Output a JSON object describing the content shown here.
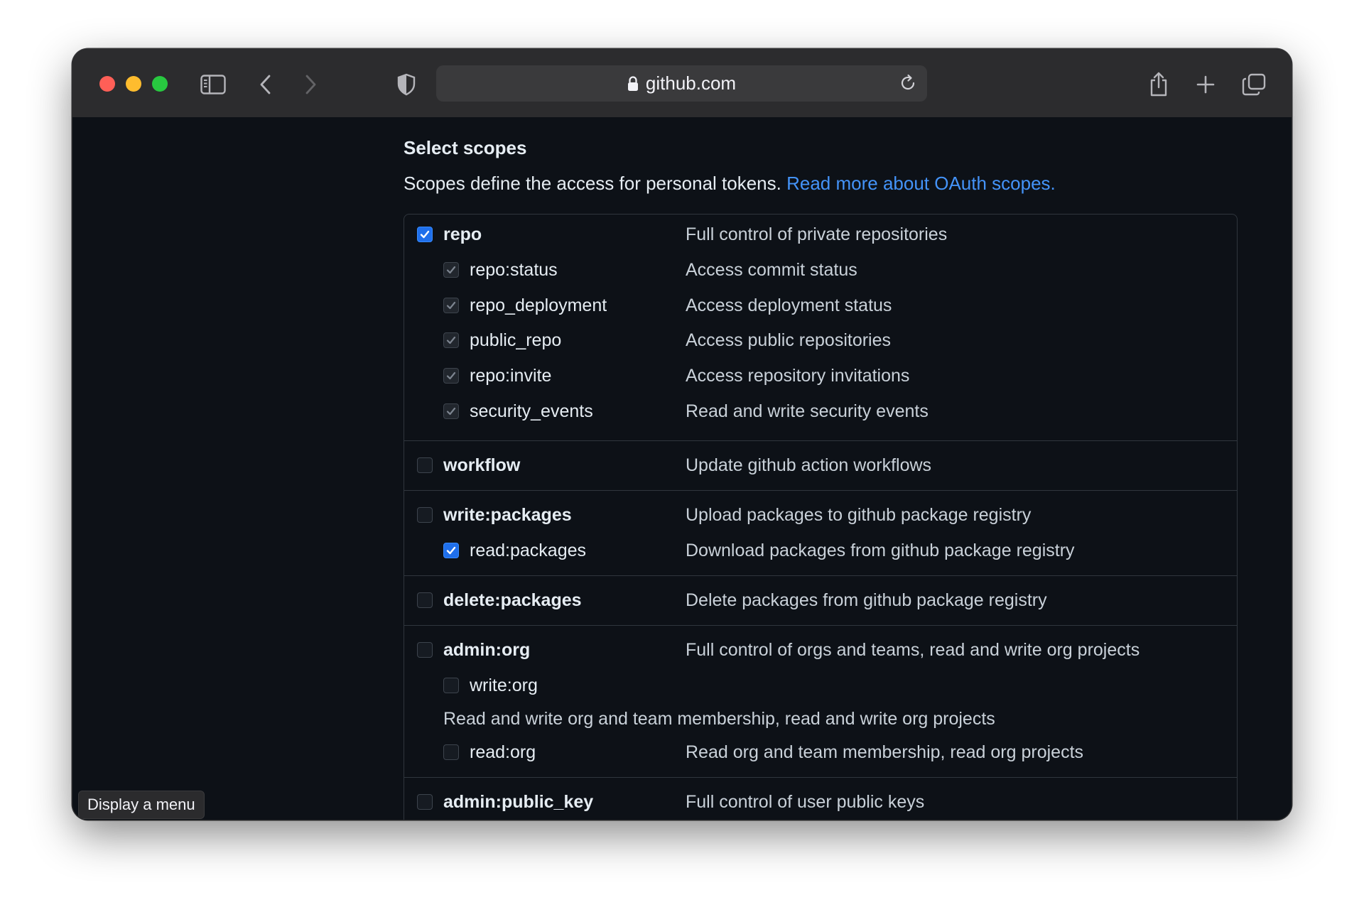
{
  "browser": {
    "address": "github.com",
    "colors": {
      "close": "#ff5f57",
      "minimize": "#febc2e",
      "zoom": "#28c840"
    }
  },
  "page": {
    "heading": "Select scopes",
    "intro_text": "Scopes define the access for personal tokens.",
    "intro_link": "Read more about OAuth scopes."
  },
  "scopes": {
    "repo": {
      "name": "repo",
      "desc": "Full control of private repositories",
      "state": "checked"
    },
    "repo_status": {
      "name": "repo:status",
      "desc": "Access commit status",
      "state": "inherited"
    },
    "repo_deployment": {
      "name": "repo_deployment",
      "desc": "Access deployment status",
      "state": "inherited"
    },
    "public_repo": {
      "name": "public_repo",
      "desc": "Access public repositories",
      "state": "inherited"
    },
    "repo_invite": {
      "name": "repo:invite",
      "desc": "Access repository invitations",
      "state": "inherited"
    },
    "security_events": {
      "name": "security_events",
      "desc": "Read and write security events",
      "state": "inherited"
    },
    "workflow": {
      "name": "workflow",
      "desc": "Update github action workflows",
      "state": "unchecked"
    },
    "write_packages": {
      "name": "write:packages",
      "desc": "Upload packages to github package registry",
      "state": "unchecked"
    },
    "read_packages": {
      "name": "read:packages",
      "desc": "Download packages from github package registry",
      "state": "checked"
    },
    "delete_packages": {
      "name": "delete:packages",
      "desc": "Delete packages from github package registry",
      "state": "unchecked"
    },
    "admin_org": {
      "name": "admin:org",
      "desc": "Full control of orgs and teams, read and write org projects",
      "state": "unchecked"
    },
    "write_org": {
      "name": "write:org",
      "desc": "Read and write org and team membership, read and write org projects",
      "state": "unchecked"
    },
    "read_org": {
      "name": "read:org",
      "desc": "Read org and team membership, read org projects",
      "state": "unchecked"
    },
    "admin_public_key": {
      "name": "admin:public_key",
      "desc": "Full control of user public keys",
      "state": "unchecked"
    }
  },
  "tooltip": "Display a menu"
}
